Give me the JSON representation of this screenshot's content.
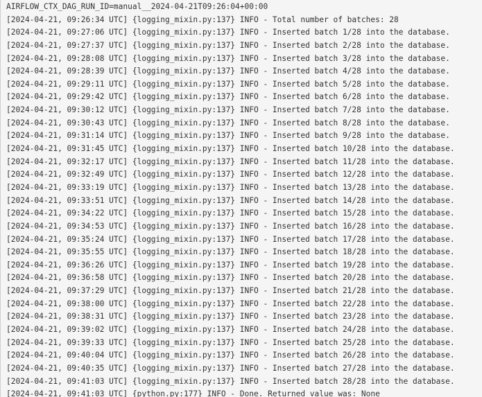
{
  "log": {
    "lines": [
      "AIRFLOW_CTX_DAG_RUN_ID=manual__2024-04-21T09:26:04+00:00",
      "[2024-04-21, 09:26:34 UTC] {logging_mixin.py:137} INFO - Total number of batches: 28",
      "[2024-04-21, 09:27:06 UTC] {logging_mixin.py:137} INFO - Inserted batch 1/28 into the database.",
      "[2024-04-21, 09:27:37 UTC] {logging_mixin.py:137} INFO - Inserted batch 2/28 into the database.",
      "[2024-04-21, 09:28:08 UTC] {logging_mixin.py:137} INFO - Inserted batch 3/28 into the database.",
      "[2024-04-21, 09:28:39 UTC] {logging_mixin.py:137} INFO - Inserted batch 4/28 into the database.",
      "[2024-04-21, 09:29:11 UTC] {logging_mixin.py:137} INFO - Inserted batch 5/28 into the database.",
      "[2024-04-21, 09:29:42 UTC] {logging_mixin.py:137} INFO - Inserted batch 6/28 into the database.",
      "[2024-04-21, 09:30:12 UTC] {logging_mixin.py:137} INFO - Inserted batch 7/28 into the database.",
      "[2024-04-21, 09:30:43 UTC] {logging_mixin.py:137} INFO - Inserted batch 8/28 into the database.",
      "[2024-04-21, 09:31:14 UTC] {logging_mixin.py:137} INFO - Inserted batch 9/28 into the database.",
      "[2024-04-21, 09:31:45 UTC] {logging_mixin.py:137} INFO - Inserted batch 10/28 into the database.",
      "[2024-04-21, 09:32:17 UTC] {logging_mixin.py:137} INFO - Inserted batch 11/28 into the database.",
      "[2024-04-21, 09:32:49 UTC] {logging_mixin.py:137} INFO - Inserted batch 12/28 into the database.",
      "[2024-04-21, 09:33:19 UTC] {logging_mixin.py:137} INFO - Inserted batch 13/28 into the database.",
      "[2024-04-21, 09:33:51 UTC] {logging_mixin.py:137} INFO - Inserted batch 14/28 into the database.",
      "[2024-04-21, 09:34:22 UTC] {logging_mixin.py:137} INFO - Inserted batch 15/28 into the database.",
      "[2024-04-21, 09:34:53 UTC] {logging_mixin.py:137} INFO - Inserted batch 16/28 into the database.",
      "[2024-04-21, 09:35:24 UTC] {logging_mixin.py:137} INFO - Inserted batch 17/28 into the database.",
      "[2024-04-21, 09:35:55 UTC] {logging_mixin.py:137} INFO - Inserted batch 18/28 into the database.",
      "[2024-04-21, 09:36:26 UTC] {logging_mixin.py:137} INFO - Inserted batch 19/28 into the database.",
      "[2024-04-21, 09:36:58 UTC] {logging_mixin.py:137} INFO - Inserted batch 20/28 into the database.",
      "[2024-04-21, 09:37:29 UTC] {logging_mixin.py:137} INFO - Inserted batch 21/28 into the database.",
      "[2024-04-21, 09:38:00 UTC] {logging_mixin.py:137} INFO - Inserted batch 22/28 into the database.",
      "[2024-04-21, 09:38:31 UTC] {logging_mixin.py:137} INFO - Inserted batch 23/28 into the database.",
      "[2024-04-21, 09:39:02 UTC] {logging_mixin.py:137} INFO - Inserted batch 24/28 into the database.",
      "[2024-04-21, 09:39:33 UTC] {logging_mixin.py:137} INFO - Inserted batch 25/28 into the database.",
      "[2024-04-21, 09:40:04 UTC] {logging_mixin.py:137} INFO - Inserted batch 26/28 into the database.",
      "[2024-04-21, 09:40:35 UTC] {logging_mixin.py:137} INFO - Inserted batch 27/28 into the database.",
      "[2024-04-21, 09:41:03 UTC] {logging_mixin.py:137} INFO - Inserted batch 28/28 into the database.",
      "[2024-04-21, 09:41:03 UTC] {python.py:177} INFO - Done. Returned value was: None"
    ]
  }
}
